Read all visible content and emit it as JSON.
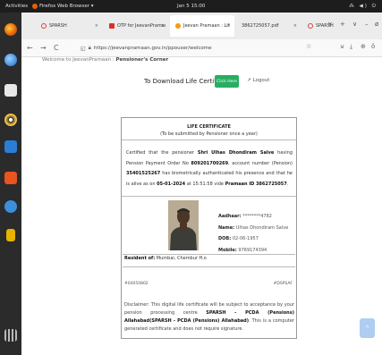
{
  "system": {
    "activities": "Activities",
    "app_menu": "Firefox Web Browser ▾",
    "clock": "Jan 5  15:00",
    "tray": "⁂ ◀) ⏻"
  },
  "tabs": [
    {
      "label": "SPARSH"
    },
    {
      "label": "OTP for JeevanPramaı"
    },
    {
      "label": "Jeevan Pramaan : Lif"
    },
    {
      "label": "3862725057.pdf"
    },
    {
      "label": "SPARSH"
    }
  ],
  "tab_controls": {
    "close": "×",
    "new_tab": "+",
    "list": "∨",
    "minimize": "–",
    "close_window": "ø"
  },
  "nav": {
    "back": "←",
    "forward": "→",
    "reload": "C"
  },
  "url": {
    "value": "https://jeevanpramaan.gov.in/ppouser/welcome"
  },
  "toolbar_icons": {
    "bookmark": "☆",
    "pocket": "⊍",
    "download": "⤓",
    "extensions": "⊕",
    "account": "ô"
  },
  "page": {
    "welcome_prefix": "Welcome to JeevanPramaan :",
    "welcome_role": "Pensioner's Corner",
    "download_text": "To Download Life Certificate",
    "click_here": "Click Here",
    "logout": "Logout",
    "certificate": {
      "title": "LIFE CERTIFICATE",
      "subtitle": "(To be submitted by Pensioner once a year)",
      "t1": "Certified that the pensioner ",
      "name": "Shri Ulhas Dhondiram Salve",
      "t2": " having Pension Payment Order No ",
      "ppo": "809201700269",
      "t3": ", account number (Pension) ",
      "account": "35401525267",
      "t4": " has biometrically authenticated his presence and that he is alive as on ",
      "date": "05-01-2024",
      "t5": " at 15:51:58 vide ",
      "pramaan_label": "Pramaan ID",
      "pramaan_id": "3862725057",
      "t6": ".",
      "aadhaar_label": "Aadhaar:",
      "aadhaar_value": "********4782",
      "name_label": "Name:",
      "name_value": "Ulhas Dhondiram Salve",
      "dob_label": "DOB:",
      "dob_value": "02-06-1957",
      "mobile_label": "Mobile:",
      "mobile_value": "9769174394",
      "resident_label": "Resident of:",
      "resident_value": " Mumbai, Chembur H.o",
      "code_left": "#04050802",
      "code_right": "#DSPSAF",
      "d1": "Disclaimer: This digital life certificate will be subject to acceptance by your pension processing centre ",
      "d2": "SPARSH - PCDA (Pensions) Allahabad(SPARSH - PCDA (Pensions) Allahabad)",
      "d3": ". This is a computer generated certificate and does not require signature."
    },
    "scroll_top": "^"
  },
  "colors": {
    "button_green": "#27ae60",
    "scroll_top": "#aecdf1"
  }
}
